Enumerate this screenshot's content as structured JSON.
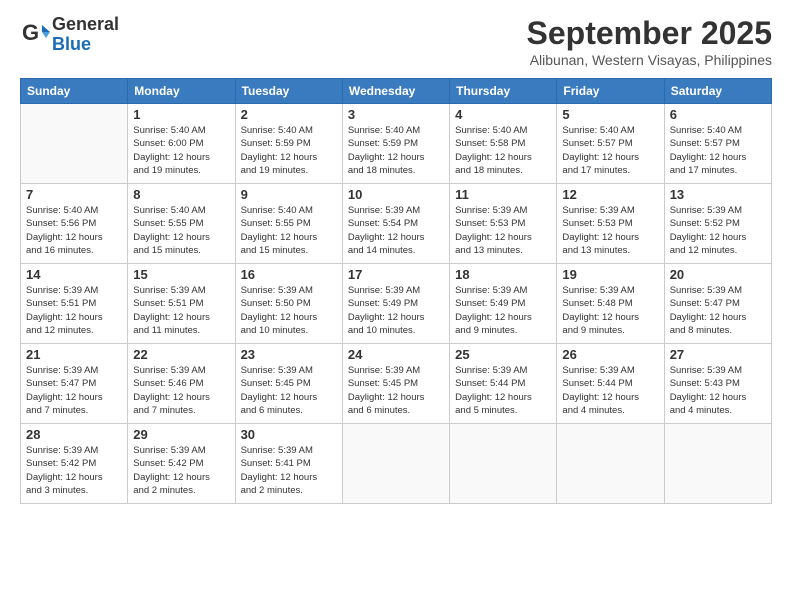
{
  "logo": {
    "text_general": "General",
    "text_blue": "Blue"
  },
  "header": {
    "month": "September 2025",
    "location": "Alibunan, Western Visayas, Philippines"
  },
  "columns": [
    "Sunday",
    "Monday",
    "Tuesday",
    "Wednesday",
    "Thursday",
    "Friday",
    "Saturday"
  ],
  "weeks": [
    [
      {
        "day": "",
        "info": ""
      },
      {
        "day": "1",
        "info": "Sunrise: 5:40 AM\nSunset: 6:00 PM\nDaylight: 12 hours\nand 19 minutes."
      },
      {
        "day": "2",
        "info": "Sunrise: 5:40 AM\nSunset: 5:59 PM\nDaylight: 12 hours\nand 19 minutes."
      },
      {
        "day": "3",
        "info": "Sunrise: 5:40 AM\nSunset: 5:59 PM\nDaylight: 12 hours\nand 18 minutes."
      },
      {
        "day": "4",
        "info": "Sunrise: 5:40 AM\nSunset: 5:58 PM\nDaylight: 12 hours\nand 18 minutes."
      },
      {
        "day": "5",
        "info": "Sunrise: 5:40 AM\nSunset: 5:57 PM\nDaylight: 12 hours\nand 17 minutes."
      },
      {
        "day": "6",
        "info": "Sunrise: 5:40 AM\nSunset: 5:57 PM\nDaylight: 12 hours\nand 17 minutes."
      }
    ],
    [
      {
        "day": "7",
        "info": "Sunrise: 5:40 AM\nSunset: 5:56 PM\nDaylight: 12 hours\nand 16 minutes."
      },
      {
        "day": "8",
        "info": "Sunrise: 5:40 AM\nSunset: 5:55 PM\nDaylight: 12 hours\nand 15 minutes."
      },
      {
        "day": "9",
        "info": "Sunrise: 5:40 AM\nSunset: 5:55 PM\nDaylight: 12 hours\nand 15 minutes."
      },
      {
        "day": "10",
        "info": "Sunrise: 5:39 AM\nSunset: 5:54 PM\nDaylight: 12 hours\nand 14 minutes."
      },
      {
        "day": "11",
        "info": "Sunrise: 5:39 AM\nSunset: 5:53 PM\nDaylight: 12 hours\nand 13 minutes."
      },
      {
        "day": "12",
        "info": "Sunrise: 5:39 AM\nSunset: 5:53 PM\nDaylight: 12 hours\nand 13 minutes."
      },
      {
        "day": "13",
        "info": "Sunrise: 5:39 AM\nSunset: 5:52 PM\nDaylight: 12 hours\nand 12 minutes."
      }
    ],
    [
      {
        "day": "14",
        "info": "Sunrise: 5:39 AM\nSunset: 5:51 PM\nDaylight: 12 hours\nand 12 minutes."
      },
      {
        "day": "15",
        "info": "Sunrise: 5:39 AM\nSunset: 5:51 PM\nDaylight: 12 hours\nand 11 minutes."
      },
      {
        "day": "16",
        "info": "Sunrise: 5:39 AM\nSunset: 5:50 PM\nDaylight: 12 hours\nand 10 minutes."
      },
      {
        "day": "17",
        "info": "Sunrise: 5:39 AM\nSunset: 5:49 PM\nDaylight: 12 hours\nand 10 minutes."
      },
      {
        "day": "18",
        "info": "Sunrise: 5:39 AM\nSunset: 5:49 PM\nDaylight: 12 hours\nand 9 minutes."
      },
      {
        "day": "19",
        "info": "Sunrise: 5:39 AM\nSunset: 5:48 PM\nDaylight: 12 hours\nand 9 minutes."
      },
      {
        "day": "20",
        "info": "Sunrise: 5:39 AM\nSunset: 5:47 PM\nDaylight: 12 hours\nand 8 minutes."
      }
    ],
    [
      {
        "day": "21",
        "info": "Sunrise: 5:39 AM\nSunset: 5:47 PM\nDaylight: 12 hours\nand 7 minutes."
      },
      {
        "day": "22",
        "info": "Sunrise: 5:39 AM\nSunset: 5:46 PM\nDaylight: 12 hours\nand 7 minutes."
      },
      {
        "day": "23",
        "info": "Sunrise: 5:39 AM\nSunset: 5:45 PM\nDaylight: 12 hours\nand 6 minutes."
      },
      {
        "day": "24",
        "info": "Sunrise: 5:39 AM\nSunset: 5:45 PM\nDaylight: 12 hours\nand 6 minutes."
      },
      {
        "day": "25",
        "info": "Sunrise: 5:39 AM\nSunset: 5:44 PM\nDaylight: 12 hours\nand 5 minutes."
      },
      {
        "day": "26",
        "info": "Sunrise: 5:39 AM\nSunset: 5:44 PM\nDaylight: 12 hours\nand 4 minutes."
      },
      {
        "day": "27",
        "info": "Sunrise: 5:39 AM\nSunset: 5:43 PM\nDaylight: 12 hours\nand 4 minutes."
      }
    ],
    [
      {
        "day": "28",
        "info": "Sunrise: 5:39 AM\nSunset: 5:42 PM\nDaylight: 12 hours\nand 3 minutes."
      },
      {
        "day": "29",
        "info": "Sunrise: 5:39 AM\nSunset: 5:42 PM\nDaylight: 12 hours\nand 2 minutes."
      },
      {
        "day": "30",
        "info": "Sunrise: 5:39 AM\nSunset: 5:41 PM\nDaylight: 12 hours\nand 2 minutes."
      },
      {
        "day": "",
        "info": ""
      },
      {
        "day": "",
        "info": ""
      },
      {
        "day": "",
        "info": ""
      },
      {
        "day": "",
        "info": ""
      }
    ]
  ]
}
